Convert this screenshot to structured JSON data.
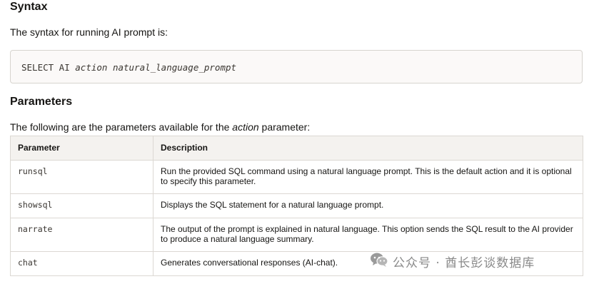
{
  "syntax": {
    "heading": "Syntax",
    "intro": "The syntax for running AI prompt is:",
    "code_keyword": "SELECT AI",
    "code_args": "action natural_language_prompt"
  },
  "parameters": {
    "heading": "Parameters",
    "intro_prefix": "The following are the parameters available for the ",
    "intro_emph": "action",
    "intro_suffix": " parameter:",
    "table": {
      "headers": [
        "Parameter",
        "Description"
      ],
      "rows": [
        {
          "param": "runsql",
          "desc": "Run the provided SQL command using a natural language prompt. This is the default action and it is optional to specify this parameter."
        },
        {
          "param": "showsql",
          "desc": "Displays the SQL statement for a natural language prompt."
        },
        {
          "param": "narrate",
          "desc": "The output of the prompt is explained in natural language. This option sends the SQL result to the AI provider to produce a natural language summary."
        },
        {
          "param": "chat",
          "desc": "Generates conversational responses (AI-chat)."
        }
      ]
    }
  },
  "watermark": {
    "icon": "wechat-icon",
    "text": "公众号 · 酋长彭谈数据库"
  }
}
